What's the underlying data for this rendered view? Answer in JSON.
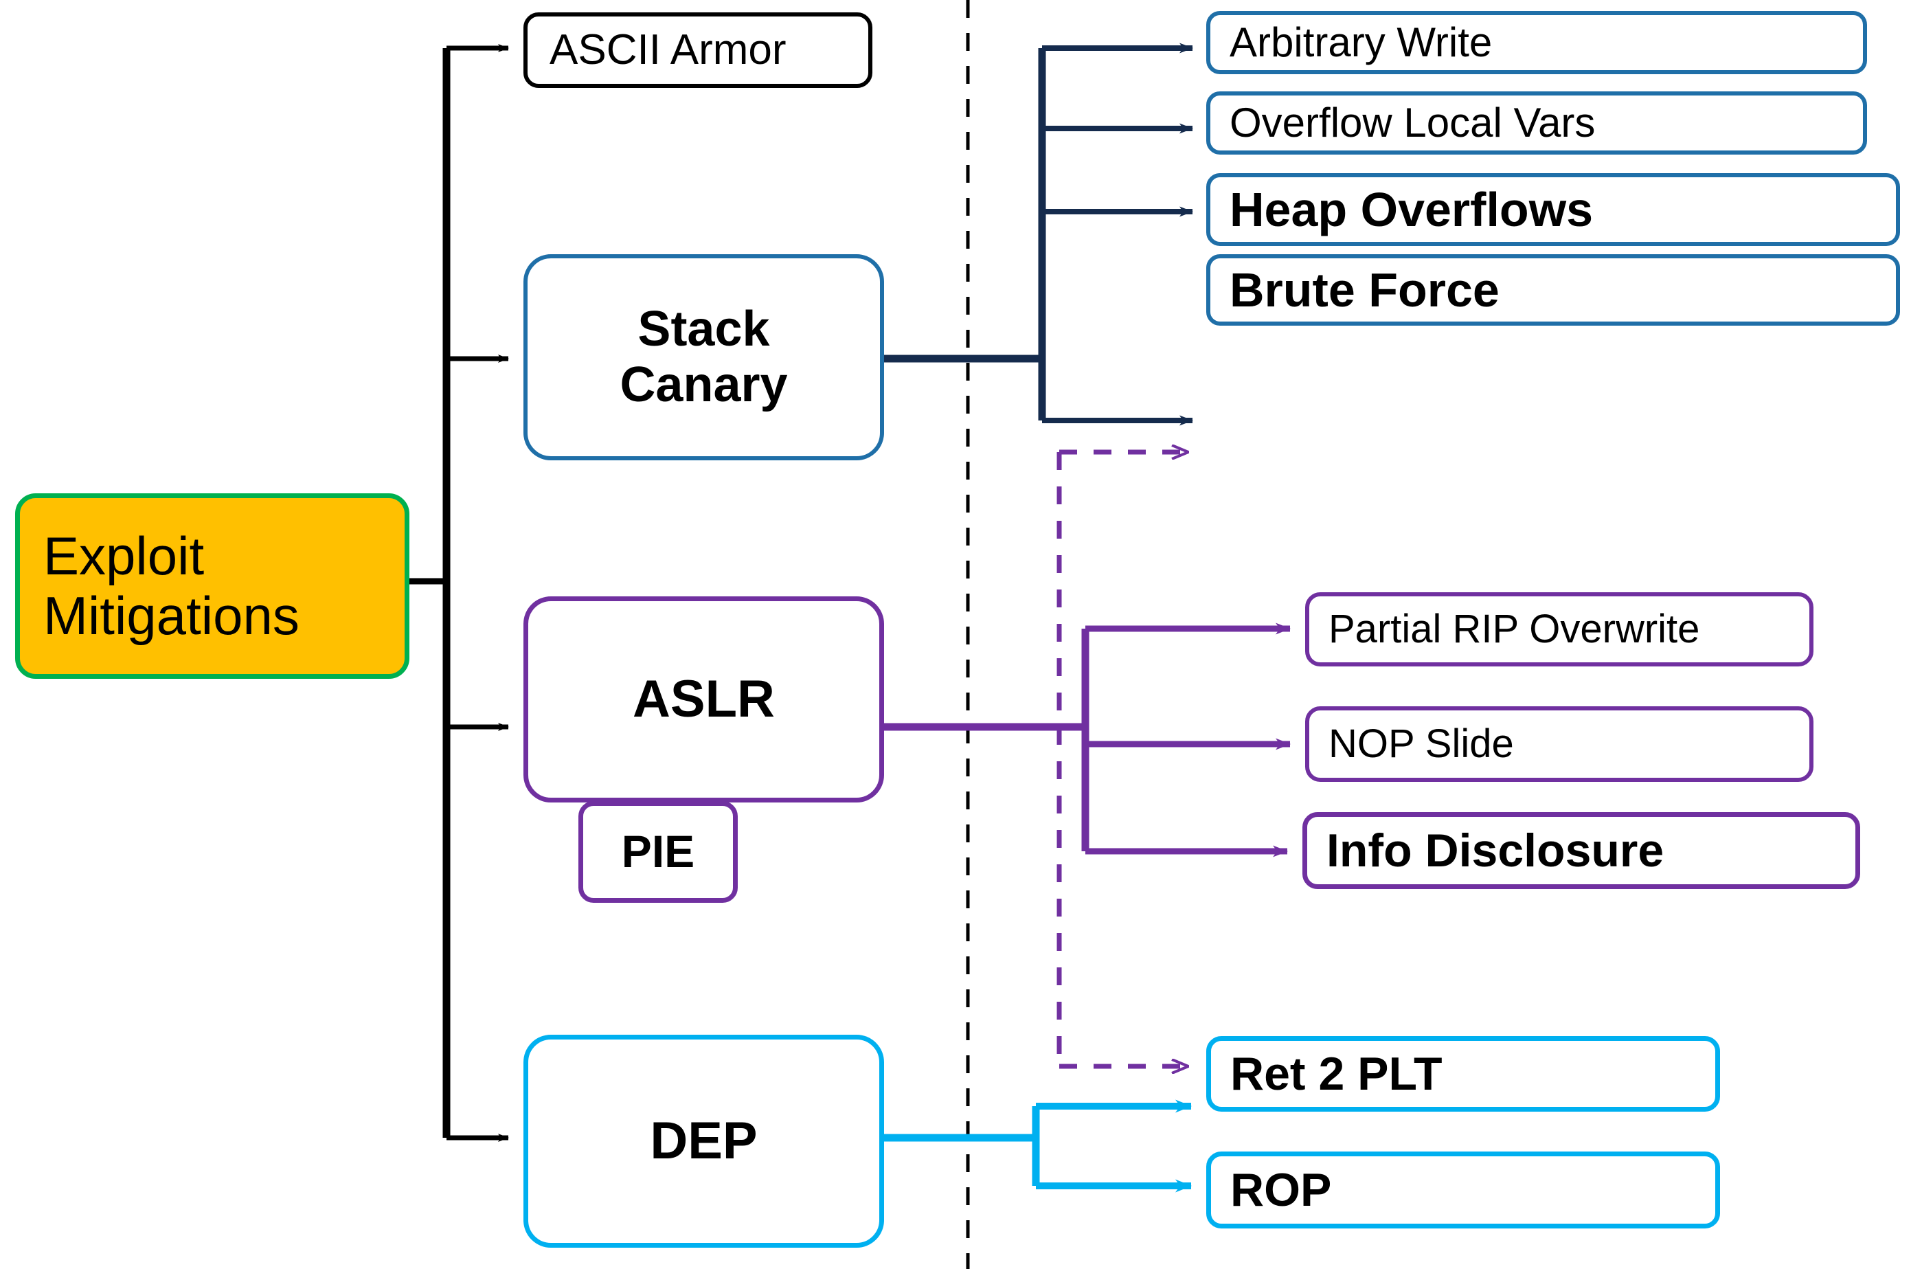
{
  "diagram": {
    "title": "Exploit Mitigations",
    "colors": {
      "root_fill": "#ffc000",
      "root_border": "#00b050",
      "canary": "#1f6fa8",
      "canary_edge": "#152b4d",
      "aslr": "#7030a0",
      "dep": "#00b0f0",
      "plain": "#000000",
      "divider": "#000000"
    },
    "root": {
      "label": "Exploit\nMitigations"
    },
    "mitigations": [
      {
        "id": "ascii-armor",
        "label": "ASCII Armor",
        "color": "#000000",
        "bold": false
      },
      {
        "id": "stack-canary",
        "label": "Stack\nCanary",
        "color": "#1f6fa8",
        "bold": true
      },
      {
        "id": "aslr",
        "label": "ASLR",
        "color": "#7030a0",
        "bold": true
      },
      {
        "id": "pie",
        "label": "PIE",
        "color": "#7030a0",
        "bold": true
      },
      {
        "id": "dep",
        "label": "DEP",
        "color": "#00b0f0",
        "bold": true
      }
    ],
    "attacks": {
      "stack_canary": [
        {
          "id": "arbitrary-write",
          "label": "Arbitrary Write",
          "bold": false
        },
        {
          "id": "overflow-local-vars",
          "label": "Overflow Local Vars",
          "bold": false
        },
        {
          "id": "heap-overflows",
          "label": "Heap Overflows",
          "bold": true
        },
        {
          "id": "brute-force",
          "label": "Brute Force",
          "bold": true
        }
      ],
      "aslr": [
        {
          "id": "partial-rip-overwrite",
          "label": "Partial RIP Overwrite",
          "bold": false
        },
        {
          "id": "nop-slide",
          "label": "NOP Slide",
          "bold": false
        },
        {
          "id": "info-disclosure",
          "label": "Info Disclosure",
          "bold": true
        }
      ],
      "dep": [
        {
          "id": "ret-2-plt",
          "label": "Ret 2 PLT",
          "bold": true
        },
        {
          "id": "rop",
          "label": "ROP",
          "bold": true
        }
      ]
    },
    "cross_links": [
      {
        "from": "aslr",
        "to": "brute-force",
        "style": "dashed",
        "color": "#7030a0"
      },
      {
        "from": "aslr",
        "to": "ret-2-plt",
        "style": "dashed",
        "color": "#7030a0"
      }
    ]
  }
}
